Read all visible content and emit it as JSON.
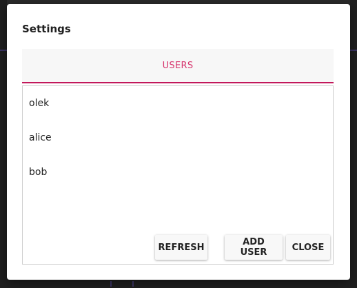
{
  "dialog": {
    "title": "Settings"
  },
  "tabs": [
    {
      "label": "USERS",
      "active": true
    }
  ],
  "users": [
    {
      "name": "olek"
    },
    {
      "name": "alice"
    },
    {
      "name": "bob"
    }
  ],
  "buttons": {
    "refresh": "REFRESH",
    "add_user": "ADD USER",
    "close": "CLOSE"
  },
  "colors": {
    "accent": "#c2185b",
    "tab_text": "#d6336c"
  }
}
